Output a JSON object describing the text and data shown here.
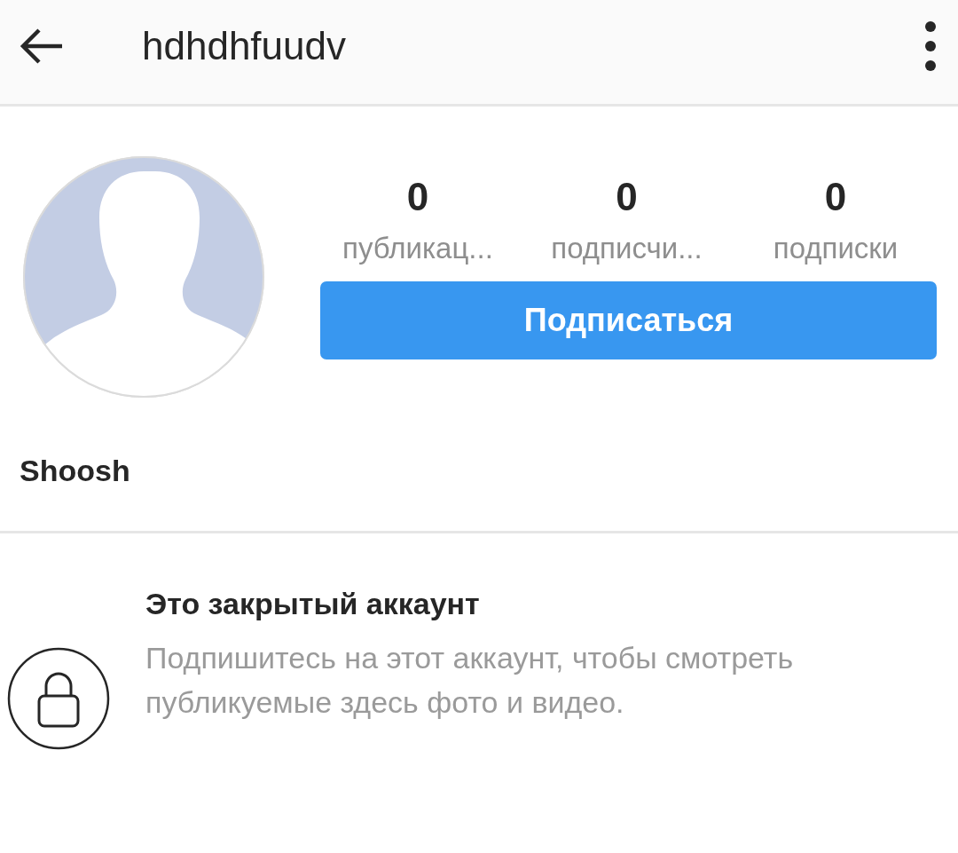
{
  "header": {
    "title": "hdhdhfuudv"
  },
  "stats": [
    {
      "value": "0",
      "label": "публикац..."
    },
    {
      "value": "0",
      "label": "подписчи..."
    },
    {
      "value": "0",
      "label": "подписки"
    }
  ],
  "follow_button": {
    "label": "Подписаться"
  },
  "profile": {
    "name": "Shoosh"
  },
  "private_notice": {
    "title": "Это закрытый аккаунт",
    "text": "Подпишитесь на этот аккаунт, чтобы смотреть публикуемые здесь фото и видео."
  }
}
